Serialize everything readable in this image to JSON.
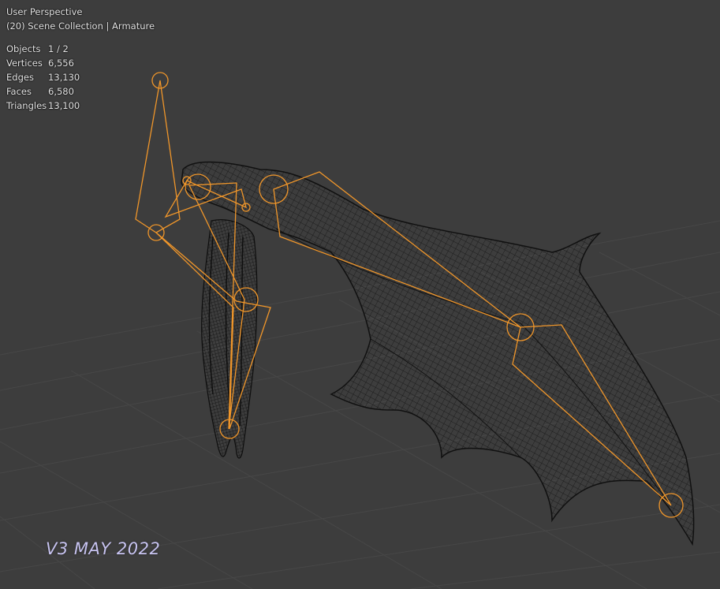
{
  "viewport": {
    "perspective_label": "User Perspective",
    "collection_label": "(20) Scene Collection | Armature",
    "stats": [
      {
        "label": "Objects",
        "value": "1 / 2"
      },
      {
        "label": "Vertices",
        "value": "6,556"
      },
      {
        "label": "Edges",
        "value": "13,130"
      },
      {
        "label": "Faces",
        "value": "6,580"
      },
      {
        "label": "Triangles",
        "value": "13,100"
      }
    ],
    "watermark": "V3 MAY 2022"
  },
  "colors": {
    "background": "#3d3d3d",
    "grid": "#474747",
    "armature": "#f0962a",
    "mesh_wire": "#101010",
    "watermark": "#c7c3f0"
  }
}
